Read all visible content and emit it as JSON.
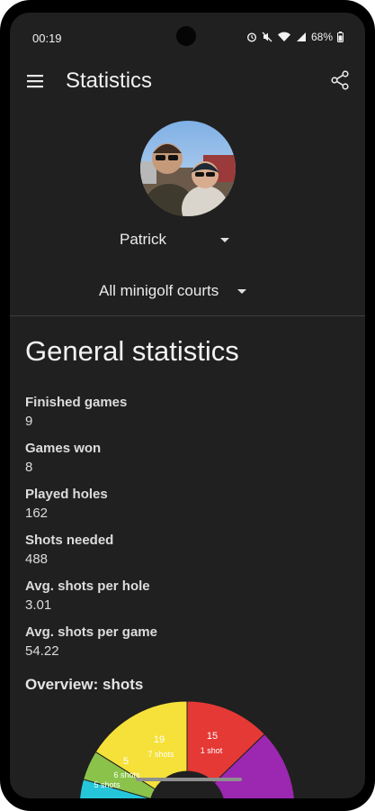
{
  "status_bar": {
    "time": "00:19",
    "battery": "68%"
  },
  "app_bar": {
    "title": "Statistics"
  },
  "player": {
    "selected": "Patrick"
  },
  "court": {
    "selected": "All minigolf courts"
  },
  "general": {
    "title": "General statistics",
    "items": [
      {
        "label": "Finished games",
        "value": "9"
      },
      {
        "label": "Games won",
        "value": "8"
      },
      {
        "label": "Played holes",
        "value": "162"
      },
      {
        "label": "Shots needed",
        "value": "488"
      },
      {
        "label": "Avg. shots per hole",
        "value": "3.01"
      },
      {
        "label": "Avg. shots per game",
        "value": "54.22"
      }
    ]
  },
  "overview": {
    "title": "Overview: shots"
  },
  "chart_data": {
    "type": "pie",
    "slices": [
      {
        "count": "15",
        "label": "1 shot",
        "color": "#e53935"
      },
      {
        "count": "19",
        "label": "7 shots",
        "color": "#f5e13a"
      },
      {
        "count": "5",
        "label": "6 shots",
        "color": "#8bc34a"
      },
      {
        "count": "",
        "label": "5 shots",
        "color": "#26c6da"
      },
      {
        "count": "",
        "label": "",
        "color": "#9c27b0"
      }
    ]
  }
}
